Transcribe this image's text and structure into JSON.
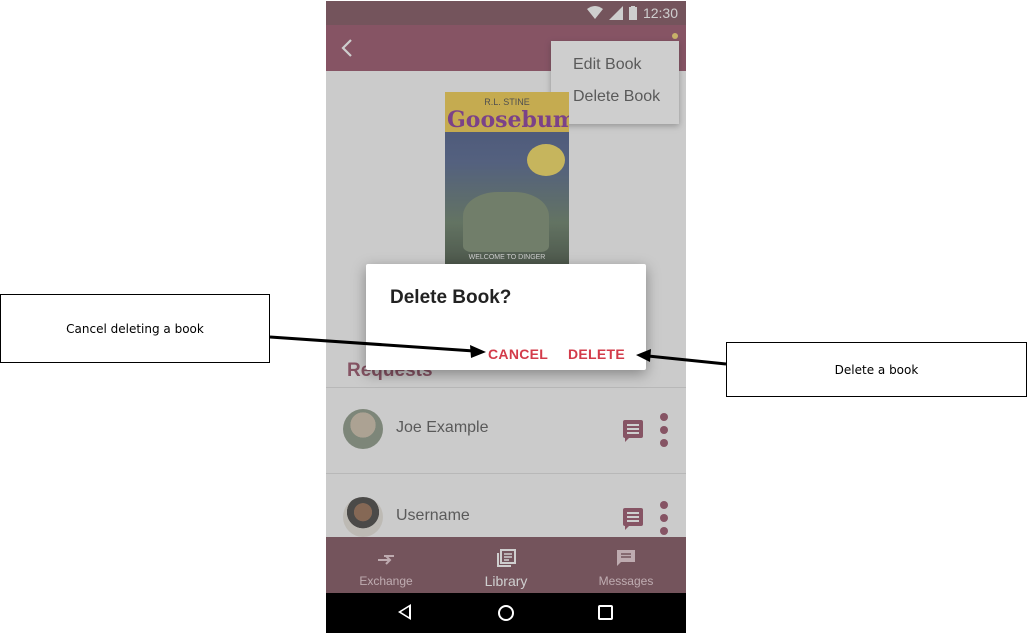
{
  "annotations": {
    "cancel_note": "Cancel deleting a book",
    "delete_note": "Delete a book"
  },
  "status_bar": {
    "time": "12:30"
  },
  "overflow_menu": {
    "items": [
      "Edit Book",
      "Delete Book"
    ]
  },
  "book": {
    "cover_author": "R.L. STINE",
    "cover_title": "Goosebumps",
    "cover_footer": "WELCOME TO DINGER"
  },
  "requests": {
    "title": "Requests",
    "rows": [
      {
        "name": "Joe Example"
      },
      {
        "name": "Username"
      }
    ]
  },
  "bottom_nav": {
    "items": [
      {
        "label": "Exchange",
        "icon": "exchange-icon",
        "active": false
      },
      {
        "label": "Library",
        "icon": "library-icon",
        "active": true
      },
      {
        "label": "Messages",
        "icon": "messages-icon",
        "active": false
      }
    ]
  },
  "dialog": {
    "title": "Delete Book?",
    "cancel_label": "CANCEL",
    "delete_label": "DELETE"
  },
  "colors": {
    "primary": "#8b3a55",
    "accent_button": "#d33b4a",
    "status_bar": "#6e3b48"
  }
}
